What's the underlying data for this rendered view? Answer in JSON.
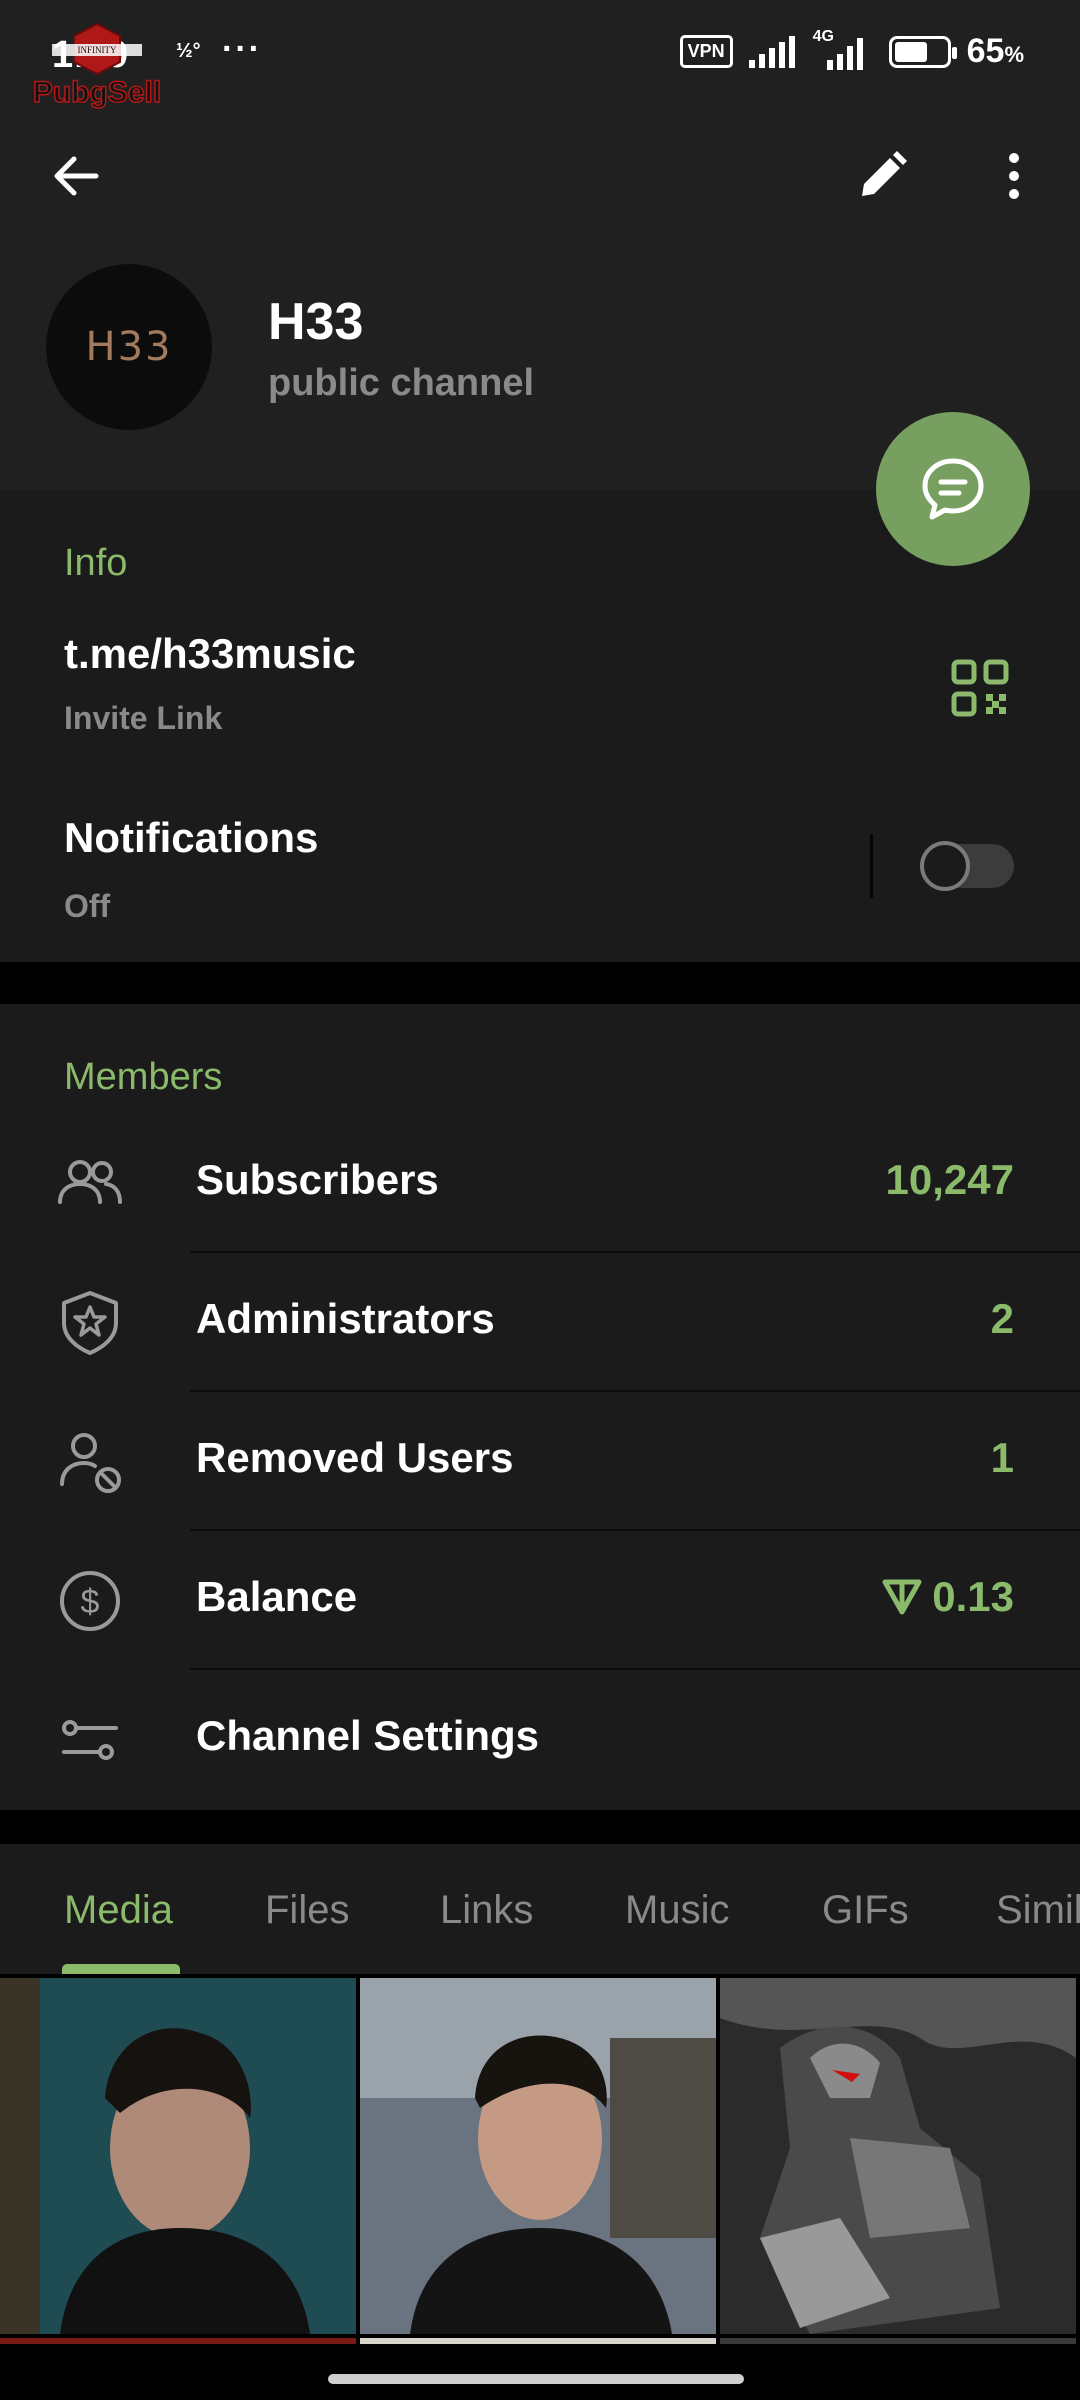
{
  "status_bar": {
    "time": "1:19",
    "data_speed": "½°",
    "more": "···",
    "vpn": "VPN",
    "network": "4G",
    "battery_percent": 65,
    "battery_label": "65",
    "battery_unit": "%",
    "watermark_text": "PubgSell"
  },
  "header": {
    "channel_name": "H33",
    "channel_type": "public channel",
    "avatar_text": "H33"
  },
  "info": {
    "section_title": "Info",
    "link": "t.me/h33music",
    "link_label": "Invite Link",
    "notifications_title": "Notifications",
    "notifications_state": "Off",
    "notifications_enabled": false
  },
  "members": {
    "section_title": "Members",
    "rows": [
      {
        "label": "Subscribers",
        "value": "10,247",
        "icon": "people-icon"
      },
      {
        "label": "Administrators",
        "value": "2",
        "icon": "shield-star-icon"
      },
      {
        "label": "Removed Users",
        "value": "1",
        "icon": "user-blocked-icon"
      },
      {
        "label": "Balance",
        "value": "0.13",
        "icon": "dollar-circle-icon"
      },
      {
        "label": "Channel Settings",
        "value": "",
        "icon": "settings-sliders-icon"
      }
    ]
  },
  "tabs": [
    {
      "label": "Media",
      "active": true
    },
    {
      "label": "Files",
      "active": false
    },
    {
      "label": "Links",
      "active": false
    },
    {
      "label": "Music",
      "active": false
    },
    {
      "label": "GIFs",
      "active": false
    },
    {
      "label": "Similar",
      "active": false
    }
  ],
  "colors": {
    "accent": "#8aba6a",
    "fab": "#77a060",
    "background": "#1b1b1b",
    "header_background": "#202020"
  }
}
